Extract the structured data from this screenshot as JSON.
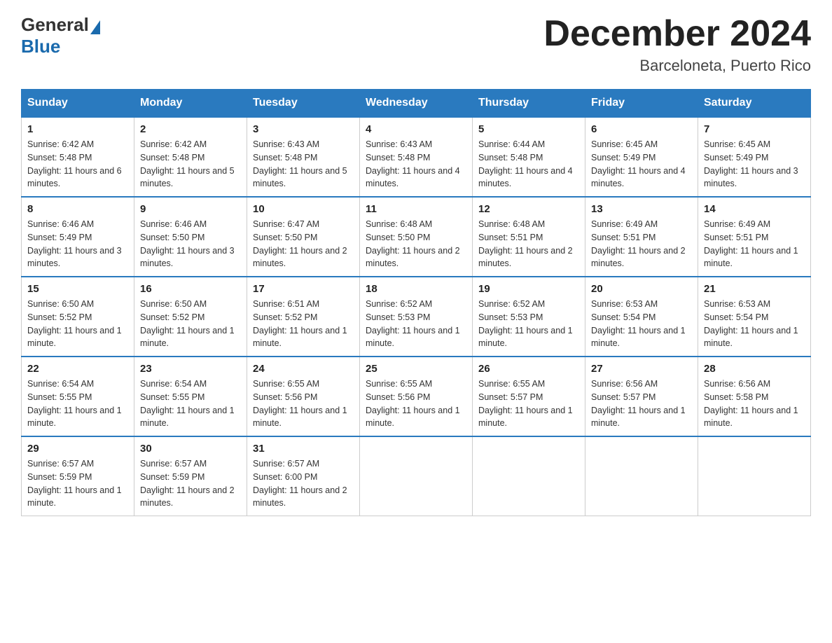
{
  "header": {
    "logo_general": "General",
    "logo_blue": "Blue",
    "month_title": "December 2024",
    "location": "Barceloneta, Puerto Rico"
  },
  "weekdays": [
    "Sunday",
    "Monday",
    "Tuesday",
    "Wednesday",
    "Thursday",
    "Friday",
    "Saturday"
  ],
  "weeks": [
    [
      {
        "day": "1",
        "sunrise": "6:42 AM",
        "sunset": "5:48 PM",
        "daylight": "11 hours and 6 minutes."
      },
      {
        "day": "2",
        "sunrise": "6:42 AM",
        "sunset": "5:48 PM",
        "daylight": "11 hours and 5 minutes."
      },
      {
        "day": "3",
        "sunrise": "6:43 AM",
        "sunset": "5:48 PM",
        "daylight": "11 hours and 5 minutes."
      },
      {
        "day": "4",
        "sunrise": "6:43 AM",
        "sunset": "5:48 PM",
        "daylight": "11 hours and 4 minutes."
      },
      {
        "day": "5",
        "sunrise": "6:44 AM",
        "sunset": "5:48 PM",
        "daylight": "11 hours and 4 minutes."
      },
      {
        "day": "6",
        "sunrise": "6:45 AM",
        "sunset": "5:49 PM",
        "daylight": "11 hours and 4 minutes."
      },
      {
        "day": "7",
        "sunrise": "6:45 AM",
        "sunset": "5:49 PM",
        "daylight": "11 hours and 3 minutes."
      }
    ],
    [
      {
        "day": "8",
        "sunrise": "6:46 AM",
        "sunset": "5:49 PM",
        "daylight": "11 hours and 3 minutes."
      },
      {
        "day": "9",
        "sunrise": "6:46 AM",
        "sunset": "5:50 PM",
        "daylight": "11 hours and 3 minutes."
      },
      {
        "day": "10",
        "sunrise": "6:47 AM",
        "sunset": "5:50 PM",
        "daylight": "11 hours and 2 minutes."
      },
      {
        "day": "11",
        "sunrise": "6:48 AM",
        "sunset": "5:50 PM",
        "daylight": "11 hours and 2 minutes."
      },
      {
        "day": "12",
        "sunrise": "6:48 AM",
        "sunset": "5:51 PM",
        "daylight": "11 hours and 2 minutes."
      },
      {
        "day": "13",
        "sunrise": "6:49 AM",
        "sunset": "5:51 PM",
        "daylight": "11 hours and 2 minutes."
      },
      {
        "day": "14",
        "sunrise": "6:49 AM",
        "sunset": "5:51 PM",
        "daylight": "11 hours and 1 minute."
      }
    ],
    [
      {
        "day": "15",
        "sunrise": "6:50 AM",
        "sunset": "5:52 PM",
        "daylight": "11 hours and 1 minute."
      },
      {
        "day": "16",
        "sunrise": "6:50 AM",
        "sunset": "5:52 PM",
        "daylight": "11 hours and 1 minute."
      },
      {
        "day": "17",
        "sunrise": "6:51 AM",
        "sunset": "5:52 PM",
        "daylight": "11 hours and 1 minute."
      },
      {
        "day": "18",
        "sunrise": "6:52 AM",
        "sunset": "5:53 PM",
        "daylight": "11 hours and 1 minute."
      },
      {
        "day": "19",
        "sunrise": "6:52 AM",
        "sunset": "5:53 PM",
        "daylight": "11 hours and 1 minute."
      },
      {
        "day": "20",
        "sunrise": "6:53 AM",
        "sunset": "5:54 PM",
        "daylight": "11 hours and 1 minute."
      },
      {
        "day": "21",
        "sunrise": "6:53 AM",
        "sunset": "5:54 PM",
        "daylight": "11 hours and 1 minute."
      }
    ],
    [
      {
        "day": "22",
        "sunrise": "6:54 AM",
        "sunset": "5:55 PM",
        "daylight": "11 hours and 1 minute."
      },
      {
        "day": "23",
        "sunrise": "6:54 AM",
        "sunset": "5:55 PM",
        "daylight": "11 hours and 1 minute."
      },
      {
        "day": "24",
        "sunrise": "6:55 AM",
        "sunset": "5:56 PM",
        "daylight": "11 hours and 1 minute."
      },
      {
        "day": "25",
        "sunrise": "6:55 AM",
        "sunset": "5:56 PM",
        "daylight": "11 hours and 1 minute."
      },
      {
        "day": "26",
        "sunrise": "6:55 AM",
        "sunset": "5:57 PM",
        "daylight": "11 hours and 1 minute."
      },
      {
        "day": "27",
        "sunrise": "6:56 AM",
        "sunset": "5:57 PM",
        "daylight": "11 hours and 1 minute."
      },
      {
        "day": "28",
        "sunrise": "6:56 AM",
        "sunset": "5:58 PM",
        "daylight": "11 hours and 1 minute."
      }
    ],
    [
      {
        "day": "29",
        "sunrise": "6:57 AM",
        "sunset": "5:59 PM",
        "daylight": "11 hours and 1 minute."
      },
      {
        "day": "30",
        "sunrise": "6:57 AM",
        "sunset": "5:59 PM",
        "daylight": "11 hours and 2 minutes."
      },
      {
        "day": "31",
        "sunrise": "6:57 AM",
        "sunset": "6:00 PM",
        "daylight": "11 hours and 2 minutes."
      },
      null,
      null,
      null,
      null
    ]
  ]
}
